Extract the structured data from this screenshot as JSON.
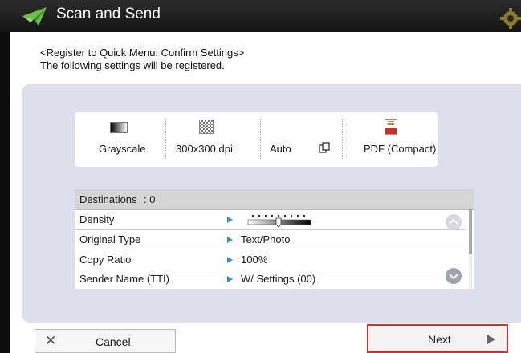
{
  "header": {
    "title": "Scan and Send"
  },
  "message": {
    "line1": "<Register to Quick Menu: Confirm Settings>",
    "line2": "The following settings will be registered."
  },
  "summary": {
    "items": [
      {
        "label": "Grayscale",
        "icon": "grayscale-icon"
      },
      {
        "label": "300x300 dpi",
        "icon": "resolution-icon"
      },
      {
        "label": "Auto",
        "icon": "paper-size-icon"
      },
      {
        "label": "PDF (Compact)",
        "icon": "pdf-file-icon"
      }
    ]
  },
  "destinations": {
    "label": "Destinations",
    "value": ": 0"
  },
  "settings": [
    {
      "label": "Density",
      "value": ""
    },
    {
      "label": "Original Type",
      "value": "Text/Photo"
    },
    {
      "label": "Copy Ratio",
      "value": "100%"
    },
    {
      "label": "Sender Name (TTI)",
      "value": "W/ Settings (00)"
    }
  ],
  "density": {
    "level": 0,
    "range": [
      -4,
      4
    ]
  },
  "buttons": {
    "cancel": "Cancel",
    "next": "Next"
  },
  "colors": {
    "accent_arrow": "#3c8bd8",
    "highlight_border": "#c0392b",
    "panel": "#dde0ea"
  }
}
